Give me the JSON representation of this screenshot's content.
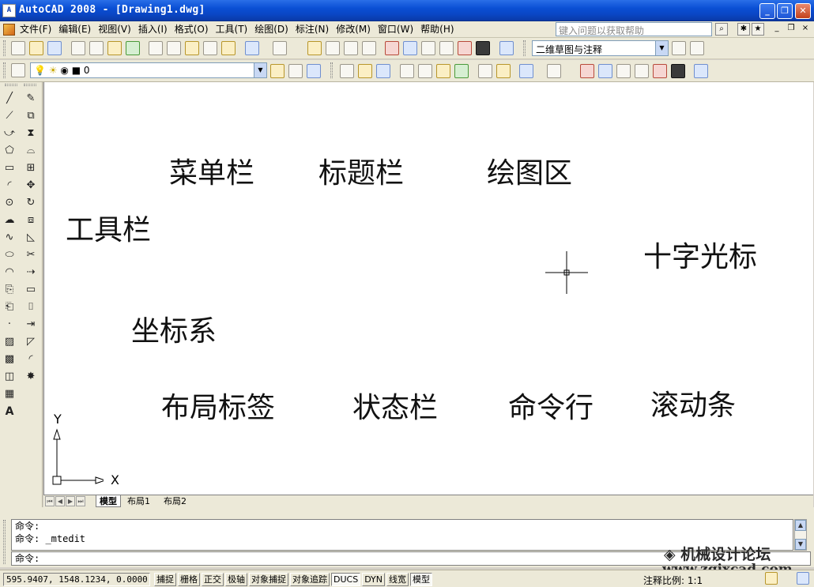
{
  "window": {
    "title": "AutoCAD 2008 - [Drawing1.dwg]",
    "app_icon": "A",
    "controls": {
      "minimize": "_",
      "restore": "❐",
      "close": "✕"
    }
  },
  "menubar": {
    "items": [
      "文件(F)",
      "编辑(E)",
      "视图(V)",
      "插入(I)",
      "格式(O)",
      "工具(T)",
      "绘图(D)",
      "标注(N)",
      "修改(M)",
      "窗口(W)",
      "帮助(H)"
    ],
    "help_search_placeholder": "键入问题以获取帮助",
    "doc_controls": {
      "minimize": "_",
      "restore": "❐",
      "close": "×"
    }
  },
  "toolbars": {
    "workspace": "二维草图与注释",
    "layer": "0",
    "combo_arrow": "▼"
  },
  "drawing_area": {
    "labels": {
      "menu_bar": "菜单栏",
      "title_bar": "标题栏",
      "drawing_area": "绘图区",
      "toolbar": "工具栏",
      "crosshair": "十字光标",
      "ucs": "坐标系",
      "layout_tabs": "布局标签",
      "status_bar": "状态栏",
      "command_line": "命令行",
      "scrollbar": "滚动条"
    },
    "ucs_axes": {
      "x": "X",
      "y": "Y"
    }
  },
  "layout_tabs": {
    "tabs": [
      "模型",
      "布局1",
      "布局2"
    ],
    "active": "模型"
  },
  "command_line": {
    "history": [
      "命令:",
      "命令: _mtedit"
    ],
    "prompt": "命令:"
  },
  "statusbar": {
    "coordinates": "595.9407, 1548.1234, 0.0000",
    "buttons": [
      {
        "label": "捕捉",
        "on": false
      },
      {
        "label": "栅格",
        "on": false
      },
      {
        "label": "正交",
        "on": false
      },
      {
        "label": "极轴",
        "on": false
      },
      {
        "label": "对象捕捉",
        "on": false
      },
      {
        "label": "对象追踪",
        "on": false
      },
      {
        "label": "DUCS",
        "on": true
      },
      {
        "label": "DYN",
        "on": false
      },
      {
        "label": "线宽",
        "on": false
      },
      {
        "label": "模型",
        "on": true
      }
    ],
    "annotation_scale": "注释比例: 1:1"
  },
  "watermark": {
    "text": "机械设计论坛",
    "url": "www.zgjxcad.com"
  }
}
